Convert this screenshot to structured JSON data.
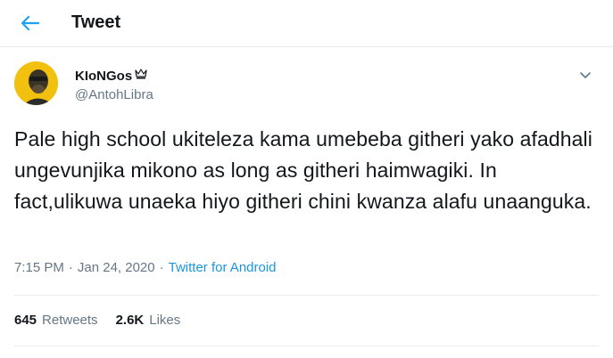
{
  "header": {
    "title": "Tweet"
  },
  "author": {
    "display_name": "KIoNGos",
    "handle": "@AntohLibra"
  },
  "tweet": {
    "text": "Pale high school ukiteleza kama umebeba githeri yako afadhali ungevunjika mikono as long as githeri haimwagiki. In fact,ulikuwa unaeka hiyo githeri chini kwanza alafu unaanguka."
  },
  "meta": {
    "time": "7:15 PM",
    "separator_1": "·",
    "date": "Jan 24, 2020",
    "separator_2": "·",
    "source": "Twitter for Android"
  },
  "stats": {
    "retweets_count": "645",
    "retweets_label": "Retweets",
    "likes_count": "2.6K",
    "likes_label": "Likes"
  },
  "colors": {
    "accent": "#1da1f2",
    "link": "#1b95e0",
    "muted": "#657786",
    "text": "#14171a",
    "divider": "#e6ecf0"
  },
  "icons": [
    "back-arrow-icon",
    "crown-icon",
    "chevron-down-icon"
  ]
}
